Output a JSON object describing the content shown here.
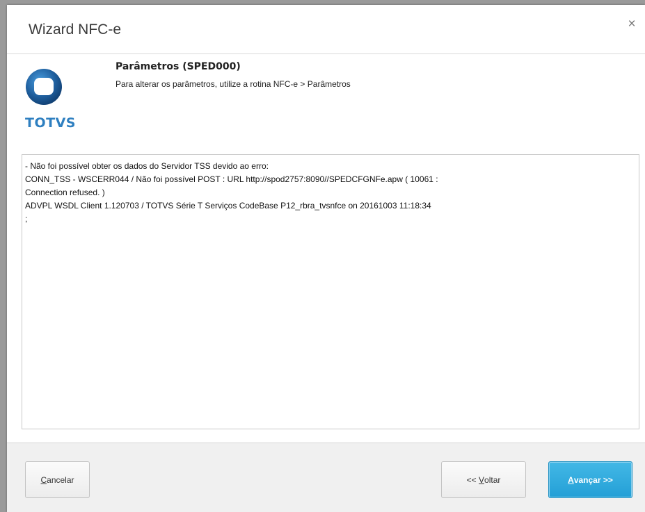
{
  "window": {
    "title": "Wizard NFC-e",
    "close_glyph": "×"
  },
  "header": {
    "logo_text": "TOTVS",
    "heading": "Parâmetros (SPED000)",
    "subheading": "Para alterar os parâmetros, utilize a rotina NFC-e > Parâmetros"
  },
  "message": {
    "lines": [
      "- Não foi possível obter os dados do Servidor TSS devido ao erro:",
      "CONN_TSS - WSCERR044 / Não foi possível POST : URL http://spod2757:8090//SPEDCFGNFe.apw ( 10061 :",
      "Connection refused. )",
      "ADVPL WSDL Client 1.120703 / TOTVS Série T Serviços CodeBase P12_rbra_tvsnfce on 20161003 11:18:34",
      ";"
    ]
  },
  "buttons": {
    "cancel_first": "C",
    "cancel_rest": "ancelar",
    "back_prefix": "<< ",
    "back_first": "V",
    "back_rest": "oltar",
    "next_first": "A",
    "next_rest": "vançar >>"
  },
  "colors": {
    "accent": "#239fd6",
    "logo_blue": "#2e7fc0"
  },
  "icons": {
    "logo": "totvs-logo-icon",
    "close": "close-icon"
  }
}
